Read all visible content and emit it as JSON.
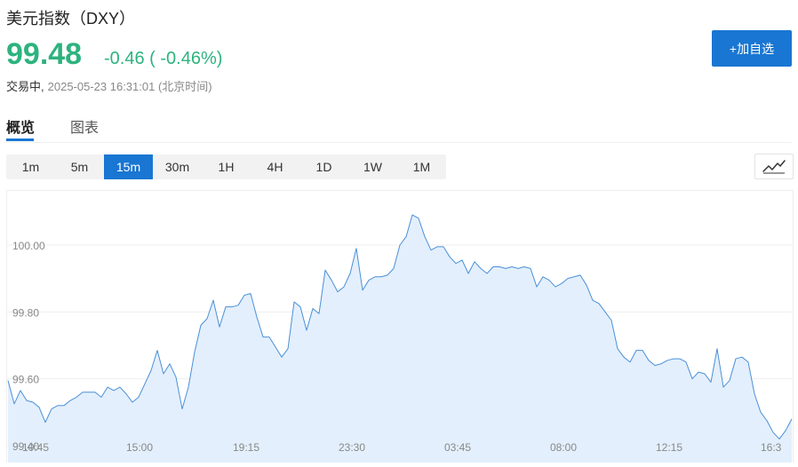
{
  "header": {
    "title": "美元指数（DXY）",
    "price": "99.48",
    "change": "-0.46 ( -0.46%)",
    "status": "交易中,",
    "timestamp": "2025-05-23 16:31:01 (北京时间)",
    "add_watchlist": "+加自选"
  },
  "tabs": [
    {
      "label": "概览",
      "active": true
    },
    {
      "label": "图表",
      "active": false
    }
  ],
  "ranges": [
    {
      "label": "1m",
      "active": false
    },
    {
      "label": "5m",
      "active": false
    },
    {
      "label": "15m",
      "active": true
    },
    {
      "label": "30m",
      "active": false
    },
    {
      "label": "1H",
      "active": false
    },
    {
      "label": "4H",
      "active": false
    },
    {
      "label": "1D",
      "active": false
    },
    {
      "label": "1W",
      "active": false
    },
    {
      "label": "1M",
      "active": false
    }
  ],
  "colors": {
    "accent": "#1976d2",
    "up_down_green": "#2cb37e",
    "line": "#4a90d9",
    "area": "#e3effc"
  },
  "chart_data": {
    "type": "area",
    "title": "",
    "xlabel": "",
    "ylabel": "",
    "ylim": [
      99.4,
      101.0
    ],
    "y_ticks": [
      "99.40",
      "99.60",
      "99.80",
      "100.00"
    ],
    "x_ticks": [
      "10:45",
      "15:00",
      "19:15",
      "23:30",
      "03:45",
      "08:00",
      "12:15",
      "16:3"
    ],
    "grid": true,
    "series": [
      {
        "values": [
          99.595,
          99.525,
          99.565,
          99.535,
          99.53,
          99.515,
          99.47,
          99.51,
          99.52,
          99.52,
          99.535,
          99.545,
          99.56,
          99.56,
          99.56,
          99.545,
          99.575,
          99.565,
          99.575,
          99.555,
          99.53,
          99.545,
          99.585,
          99.625,
          99.685,
          99.615,
          99.645,
          99.605,
          99.51,
          99.575,
          99.68,
          99.76,
          99.78,
          99.835,
          99.755,
          99.815,
          99.815,
          99.82,
          99.85,
          99.855,
          99.785,
          99.725,
          99.725,
          99.695,
          99.665,
          99.69,
          99.83,
          99.815,
          99.745,
          99.81,
          99.795,
          99.925,
          99.895,
          99.86,
          99.875,
          99.915,
          99.99,
          99.865,
          99.895,
          99.905,
          99.905,
          99.91,
          99.93,
          100.0,
          100.025,
          100.09,
          100.08,
          100.025,
          99.985,
          99.995,
          99.995,
          99.965,
          99.945,
          99.955,
          99.915,
          99.95,
          99.93,
          99.915,
          99.935,
          99.935,
          99.93,
          99.935,
          99.93,
          99.935,
          99.93,
          99.875,
          99.905,
          99.895,
          99.875,
          99.885,
          99.9,
          99.905,
          99.91,
          99.88,
          99.835,
          99.825,
          99.8,
          99.775,
          99.69,
          99.665,
          99.65,
          99.685,
          99.685,
          99.655,
          99.64,
          99.645,
          99.655,
          99.66,
          99.66,
          99.65,
          99.6,
          99.62,
          99.615,
          99.59,
          99.69,
          99.575,
          99.595,
          99.66,
          99.665,
          99.65,
          99.555,
          99.5,
          99.475,
          99.44,
          99.42,
          99.445,
          99.48
        ]
      }
    ]
  }
}
